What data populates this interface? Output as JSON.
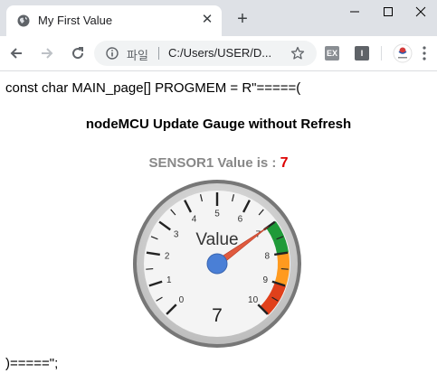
{
  "browser": {
    "tab": {
      "title": "My First Value"
    },
    "address": {
      "scheme_label": "파일",
      "url": "C:/Users/USER/D..."
    },
    "extensions": [
      {
        "label": "EX"
      },
      {
        "label": "I"
      }
    ]
  },
  "page": {
    "line_top": "const char MAIN_page[] PROGMEM = R\"=====(",
    "heading": "nodeMCU Update Gauge without Refresh",
    "sensor": {
      "label": "SENSOR1 Value is : ",
      "value": "7"
    },
    "line_bottom": ")=====\";"
  },
  "gauge": {
    "title": "Value",
    "value": 7,
    "min": 0,
    "max": 10,
    "display_value": "7",
    "tick_labels": [
      "0",
      "1",
      "2",
      "3",
      "4",
      "5",
      "6",
      "7",
      "8",
      "9",
      "10"
    ],
    "bands": [
      {
        "from": 7,
        "to": 8,
        "color": "#1f9a38"
      },
      {
        "from": 8,
        "to": 9,
        "color": "#ff9a1f"
      },
      {
        "from": 9,
        "to": 10,
        "color": "#e0401b"
      }
    ],
    "needle_color": "#e05a3e",
    "hub_color": "#4a7fd6"
  }
}
